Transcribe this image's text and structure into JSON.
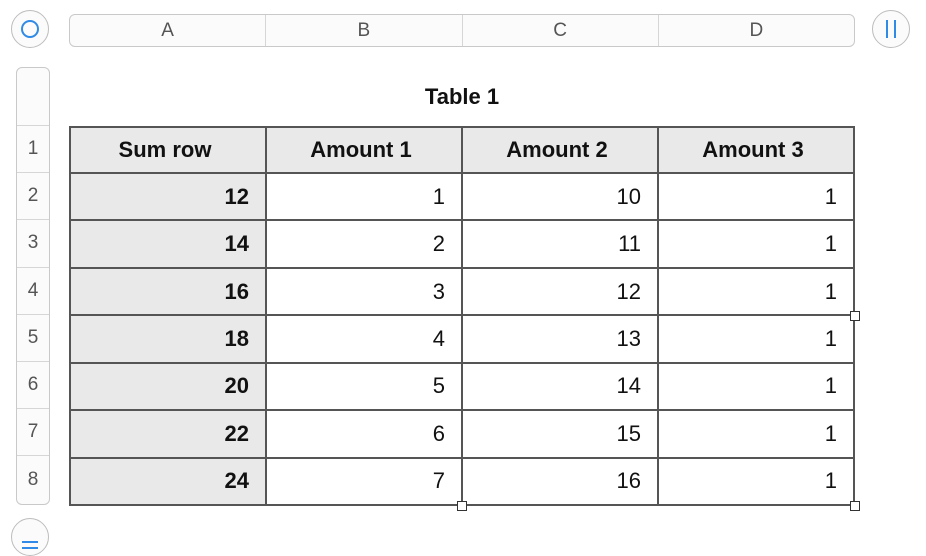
{
  "column_headers": [
    "A",
    "B",
    "C",
    "D"
  ],
  "row_headers": [
    "1",
    "2",
    "3",
    "4",
    "5",
    "6",
    "7",
    "8"
  ],
  "table": {
    "title": "Table 1",
    "headers": [
      "Sum row",
      "Amount 1",
      "Amount 2",
      "Amount 3"
    ],
    "rows": [
      [
        "12",
        "1",
        "10",
        "1"
      ],
      [
        "14",
        "2",
        "11",
        "1"
      ],
      [
        "16",
        "3",
        "12",
        "1"
      ],
      [
        "18",
        "4",
        "13",
        "1"
      ],
      [
        "20",
        "5",
        "14",
        "1"
      ],
      [
        "22",
        "6",
        "15",
        "1"
      ],
      [
        "24",
        "7",
        "16",
        "1"
      ]
    ]
  },
  "icons": {
    "select_table": "circle-icon",
    "column_handle": "column-resize-icon",
    "add_row": "row-resize-icon"
  },
  "colors": {
    "accent": "#2f8be6",
    "header_fill": "#e9e9e9",
    "grid_line": "#555555"
  }
}
